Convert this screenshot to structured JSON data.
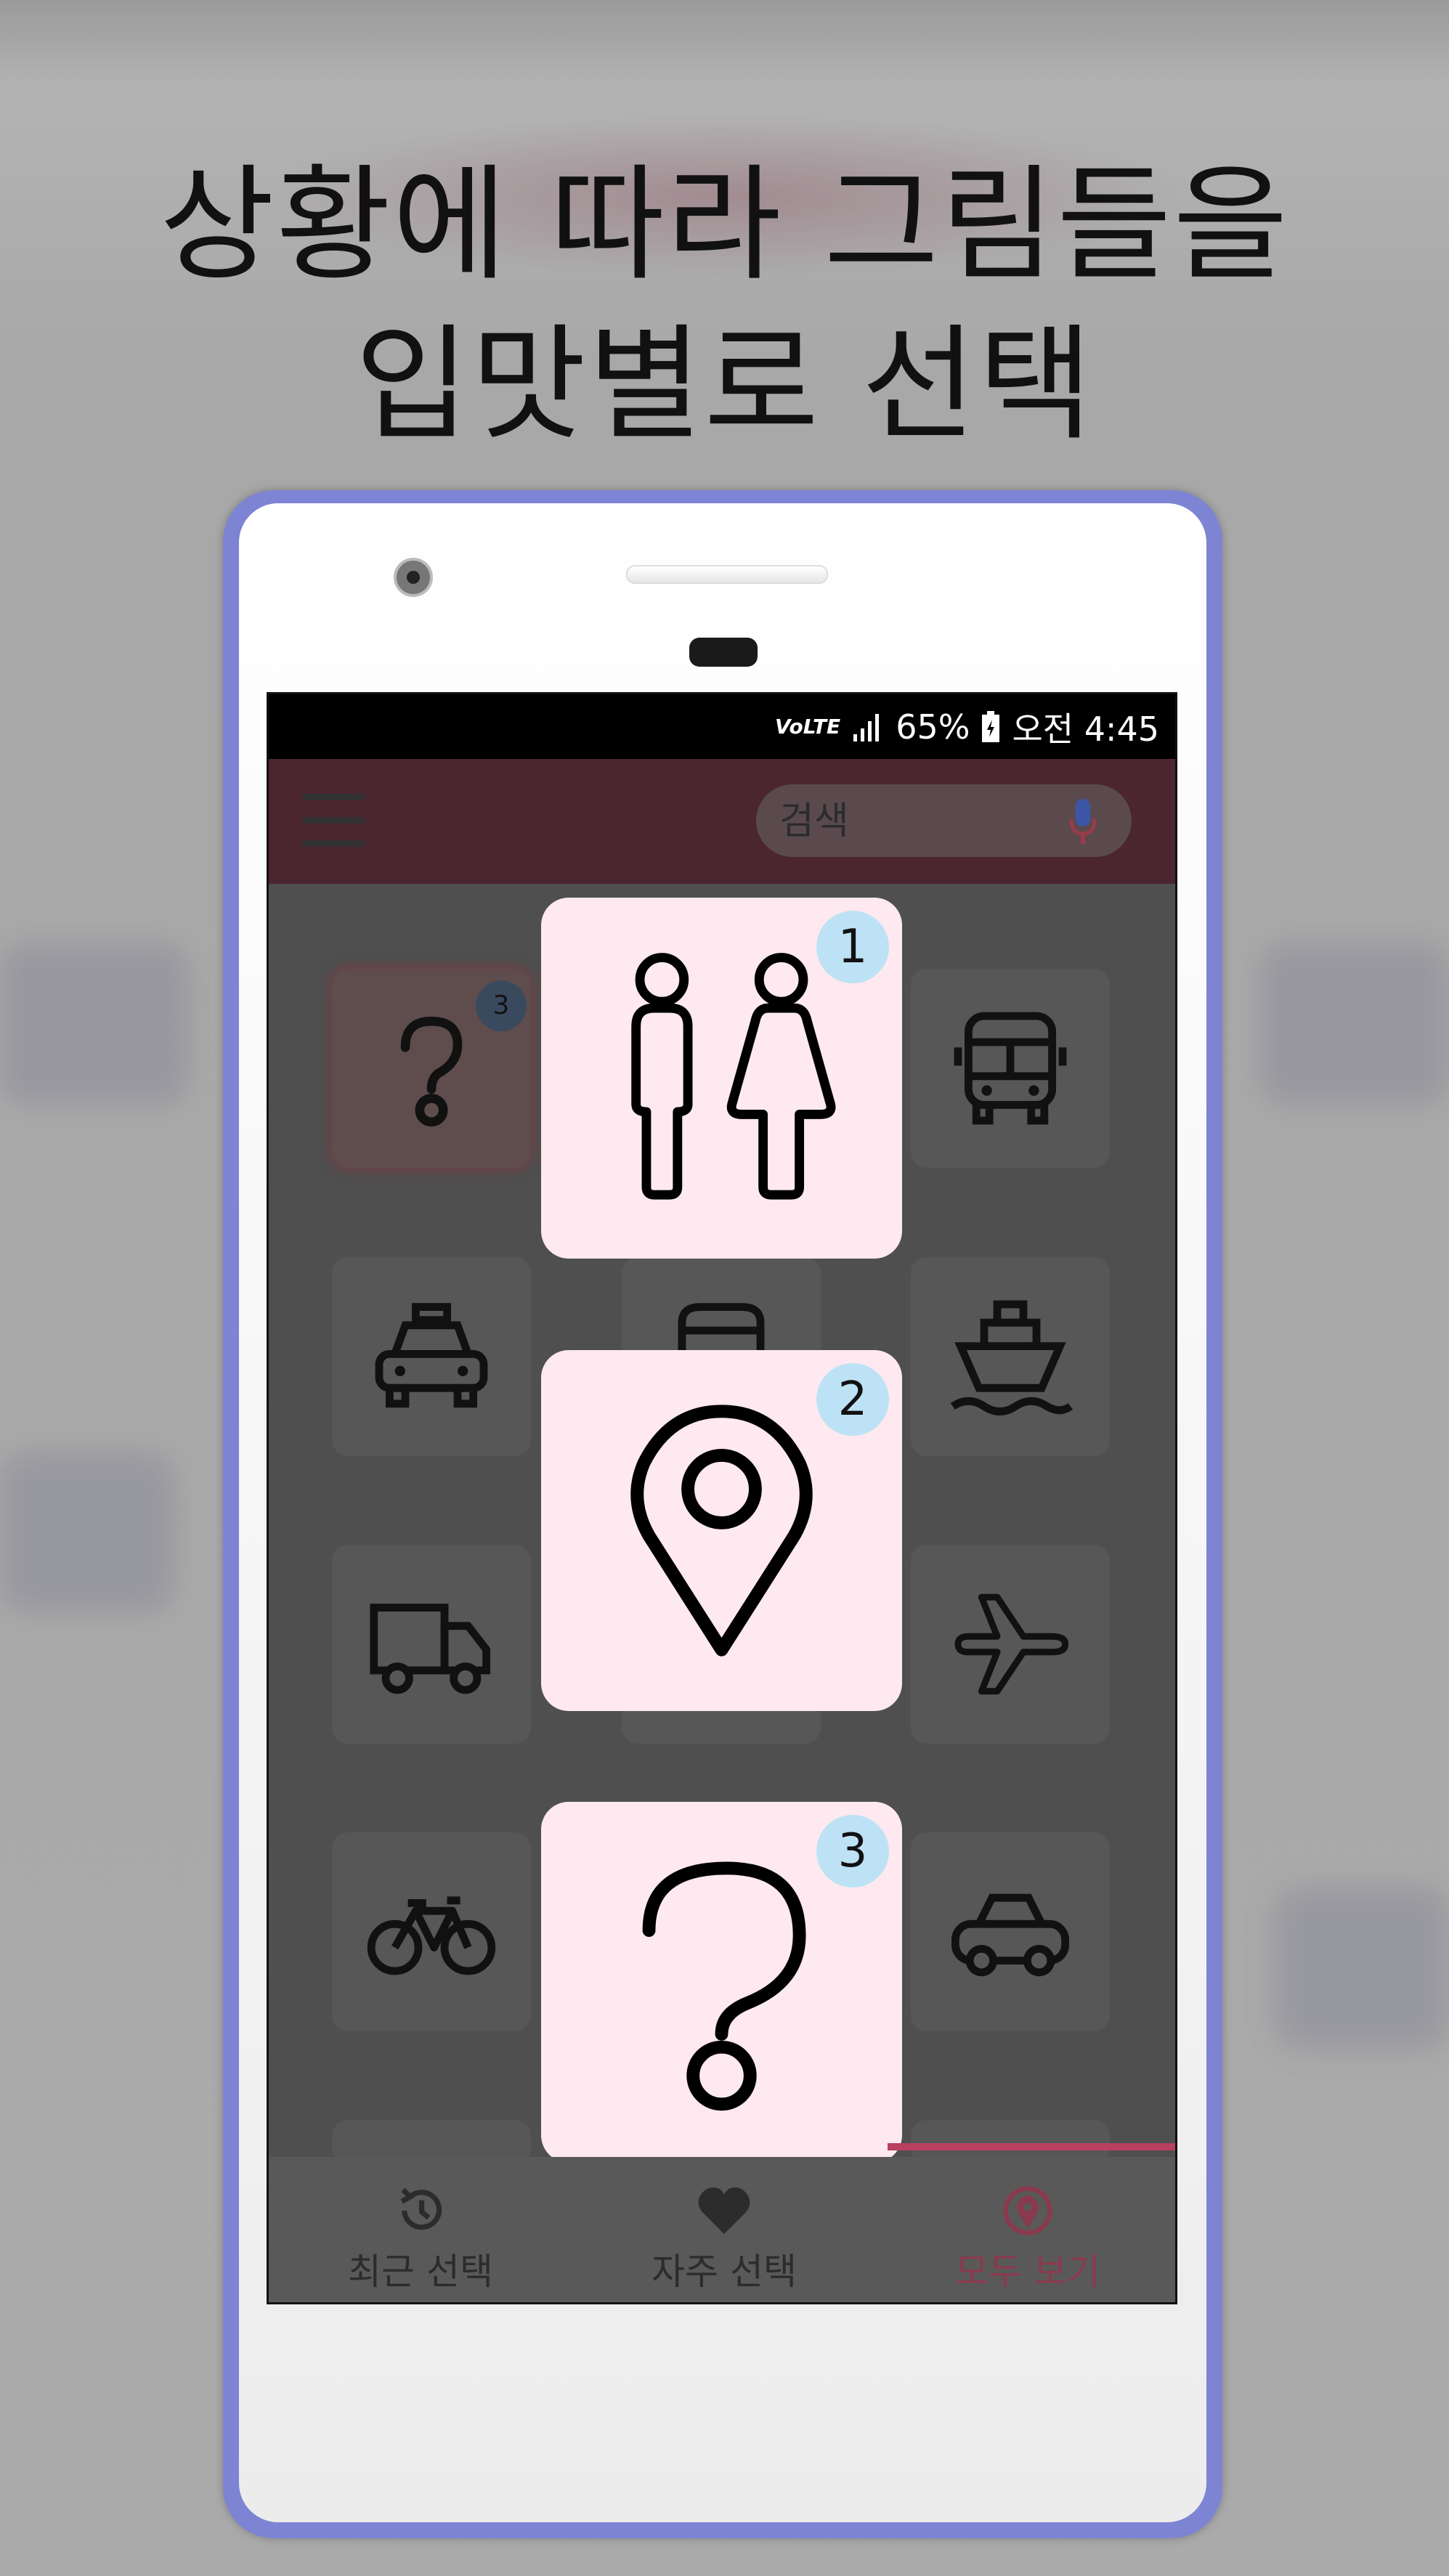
{
  "headline": {
    "line1": "상황에 따라 그림들을",
    "line2": "입맛별로 선택"
  },
  "status_bar": {
    "network": "VoLTE",
    "battery": "65%",
    "time": "오전 4:45"
  },
  "toolbar": {
    "search_placeholder": "검색"
  },
  "grid": {
    "cells": [
      {
        "icon": "question-icon",
        "badge": "3",
        "selected": true
      },
      {
        "icon": "bus-icon"
      },
      {
        "icon": "taxi-icon"
      },
      {
        "icon": "tram-icon"
      },
      {
        "icon": "ship-icon"
      },
      {
        "icon": "truck-icon"
      },
      {
        "icon": "airplane-icon"
      },
      {
        "icon": "bicycle-icon"
      },
      {
        "icon": "car-icon"
      }
    ]
  },
  "popup_cards": [
    {
      "icon": "restroom-icon",
      "badge": "1"
    },
    {
      "icon": "location-pin-icon",
      "badge": "2"
    },
    {
      "icon": "question-icon",
      "badge": "3"
    }
  ],
  "bottom_nav": {
    "items": [
      {
        "label": "최근 선택",
        "icon": "history-icon"
      },
      {
        "label": "자주 선택",
        "icon": "heart-icon"
      },
      {
        "label": "모두 보기",
        "icon": "location-pin-icon",
        "active": true
      }
    ],
    "active_color": "#b94060"
  },
  "colors": {
    "toolbar": "#4b2530",
    "card_bg": "#fde9ef",
    "badge_bg": "#bde2f5",
    "phone_frame": "#7e84d4"
  }
}
